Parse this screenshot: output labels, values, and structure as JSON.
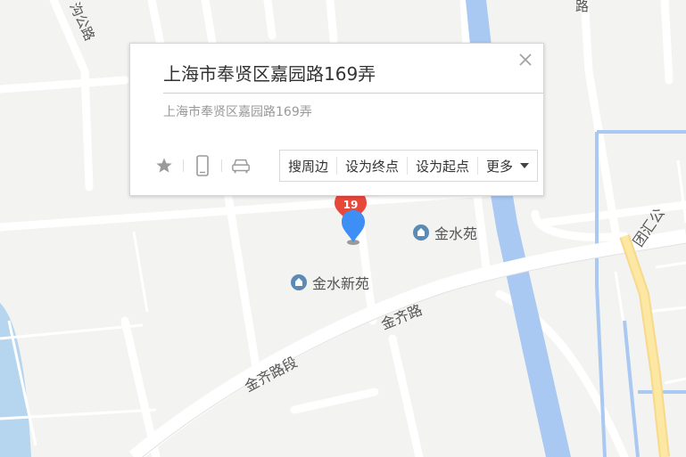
{
  "popup": {
    "title": "上海市奉贤区嘉园路169弄",
    "subtitle": "上海市奉贤区嘉园路169弄",
    "actions": {
      "nearby": "搜周边",
      "set_end": "设为终点",
      "set_start": "设为起点",
      "more": "更多"
    },
    "icons": [
      "star-icon",
      "phone-icon",
      "car-icon",
      "close-icon",
      "chevron-down-icon"
    ]
  },
  "map": {
    "pois": [
      {
        "name": "金水苑"
      },
      {
        "name": "金水新苑"
      }
    ],
    "roads": {
      "jinqi_road": "金齐路",
      "jinqi_road_section": "金齐路段",
      "tuanhui_road": "团汇公",
      "top_left_road": "沟公路",
      "top_right_road": "路"
    },
    "marker_badge": "19",
    "colors": {
      "river": "#a9c8f2",
      "water_body": "#b6d6ef",
      "highway": "#fce7a3",
      "marker_red": "#e8483a",
      "marker_blue": "#3d8ef5"
    }
  }
}
